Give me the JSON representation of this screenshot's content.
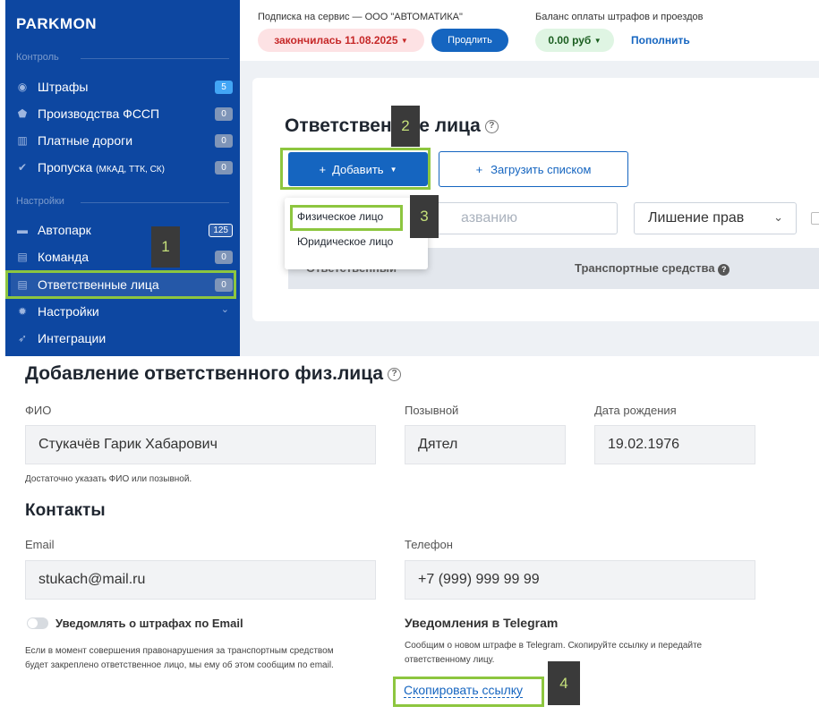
{
  "sidebar": {
    "logo": "PARKMON",
    "sections": [
      {
        "title": "Контроль"
      },
      {
        "title": "Настройки"
      }
    ],
    "items": [
      {
        "label": "Штрафы",
        "badge": "5"
      },
      {
        "label": "Производства ФССП",
        "badge": "0"
      },
      {
        "label": "Платные дороги",
        "badge": "0"
      },
      {
        "label": "Пропуска",
        "sub": "(МКАД, ТТК, СК)",
        "badge": "0"
      },
      {
        "label": "Автопарк",
        "badge": "125"
      },
      {
        "label": "Команда",
        "badge": "0"
      },
      {
        "label": "Ответственные лица",
        "badge": "0"
      },
      {
        "label": "Настройки"
      },
      {
        "label": "Интеграции"
      }
    ]
  },
  "topbar": {
    "subscription_label": "Подписка на сервис — ООО \"АВТОМАТИКА\"",
    "expired": "закончилась 11.08.2025",
    "renew": "Продлить",
    "balance_label": "Баланс оплаты штрафов и проездов",
    "balance": "0.00 руб",
    "topup": "Пополнить"
  },
  "card": {
    "title": "Ответственные лица",
    "add": "Добавить",
    "upload": "Загрузить списком",
    "search_placeholder": "азванию",
    "filter": "Лишение прав",
    "col_responsible": "Ответственный",
    "col_vehicles": "Транспортные средства",
    "dropdown": [
      "Физическое лицо",
      "Юридическое лицо"
    ]
  },
  "steps": [
    "1",
    "2",
    "3",
    "4"
  ],
  "form": {
    "title": "Добавление ответственного физ.лица",
    "fio_label": "ФИО",
    "fio_value": "Стукачёв Гарик Хабарович",
    "callsign_label": "Позывной",
    "callsign_value": "Дятел",
    "birth_label": "Дата рождения",
    "birth_value": "19.02.1976",
    "hint": "Достаточно указать ФИО или позывной.",
    "contacts": "Контакты",
    "email_label": "Email",
    "email_value": "stukach@mail.ru",
    "phone_label": "Телефон",
    "phone_value": "+7 (999) 999 99 99",
    "notify_email": "Уведомлять о штрафах по Email",
    "email_note_1": "Если в момент совершения правонарушения за транспортным средством",
    "email_note_2": "будет закреплено ответственное лицо, мы ему об этом сообщим по email.",
    "telegram_title": "Уведомления в Telegram",
    "telegram_note_1": "Сообщим о новом штрафе в Telegram. Скопируйте ссылку и передайте",
    "telegram_note_2": "ответственному лицу.",
    "copy_link": "Скопировать ссылку"
  }
}
